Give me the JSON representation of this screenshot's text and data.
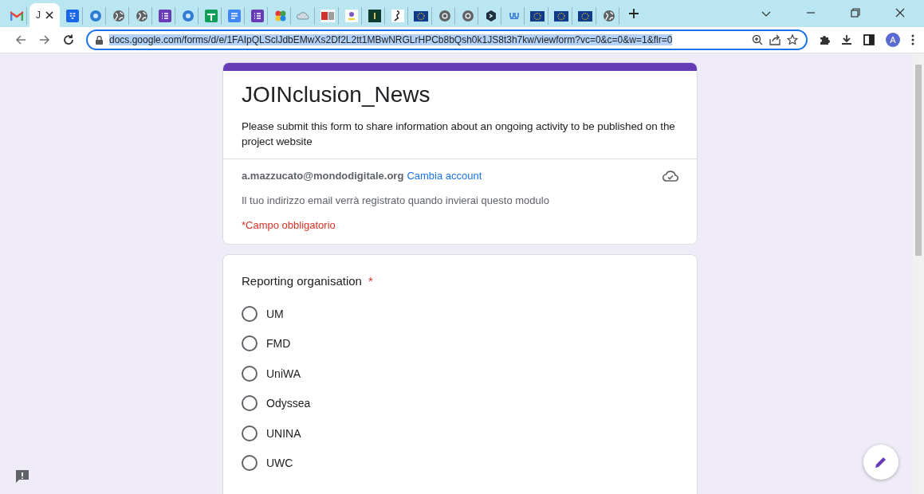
{
  "browser": {
    "tabs": [
      {
        "selected": false
      },
      {
        "selected": true,
        "title": "J"
      },
      {
        "selected": false
      },
      {
        "selected": false
      },
      {
        "selected": false
      },
      {
        "selected": false
      },
      {
        "selected": false
      },
      {
        "selected": false
      },
      {
        "selected": false
      },
      {
        "selected": false
      },
      {
        "selected": false
      },
      {
        "selected": false
      },
      {
        "selected": false
      },
      {
        "selected": false
      },
      {
        "selected": false
      },
      {
        "selected": false
      },
      {
        "selected": false
      },
      {
        "selected": false
      },
      {
        "selected": false
      },
      {
        "selected": false
      },
      {
        "selected": false
      },
      {
        "selected": false
      },
      {
        "selected": false
      },
      {
        "selected": false
      },
      {
        "selected": false
      },
      {
        "selected": false
      }
    ],
    "address": "docs.google.com/forms/d/e/1FAIpQLSclJdbEMwXs2Df2L2tt1MBwNRGLrHPCb8bQsh0k1JS8t3h7kw/viewform?vc=0&c=0&w=1&flr=0",
    "profile_initial": "A"
  },
  "form": {
    "title": "JOINclusion_News",
    "description": "Please submit this form to share information about an ongoing activity to be published on the project website",
    "email": "a.mazzucato@mondodigitale.org",
    "switch_account": "Cambia account",
    "email_note": "Il tuo indirizzo email verrà registrato quando invierai questo modulo",
    "required_note": "*Campo obbligatorio",
    "question": {
      "title": "Reporting organisation",
      "required_mark": "*",
      "options": [
        {
          "label": "UM",
          "selected": false
        },
        {
          "label": "FMD",
          "selected": false
        },
        {
          "label": "UniWA",
          "selected": false
        },
        {
          "label": "Odyssea",
          "selected": false
        },
        {
          "label": "UNINA",
          "selected": false
        },
        {
          "label": "UWC",
          "selected": false
        }
      ]
    }
  }
}
